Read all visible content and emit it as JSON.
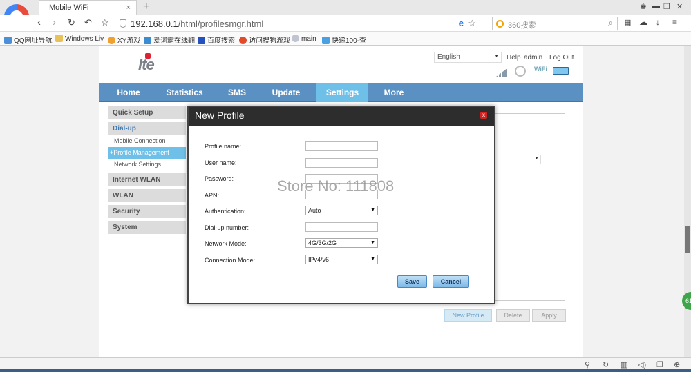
{
  "browser": {
    "tab_title": "Mobile WiFi",
    "tab_close": "×",
    "new_tab": "+",
    "url_host": "192.168.0.1",
    "url_path": "/html/profilesmgr.html",
    "search_placeholder": "360搜索",
    "bookmarks": [
      "QQ网址导航",
      "Windows Liv",
      "XY游戏",
      "爱词霸在线翻",
      "百度搜索",
      "访问搜狗游戏",
      "main",
      "快递100-查"
    ]
  },
  "header": {
    "logo_text": "lte",
    "language": "English",
    "help": "Help",
    "user": "admin",
    "logout": "Log Out"
  },
  "mainnav": [
    "Home",
    "Statistics",
    "SMS",
    "Update",
    "Settings",
    "More"
  ],
  "sidebar": {
    "quick_setup": "Quick Setup",
    "dialup": "Dial-up",
    "dialup_items": [
      "Mobile Connection",
      "+Profile Management",
      "Network Settings"
    ],
    "internet_wlan": "Internet WLAN",
    "wlan": "WLAN",
    "security": "Security",
    "system": "System"
  },
  "page_buttons": {
    "new_profile": "New Profile",
    "delete": "Delete",
    "apply": "Apply"
  },
  "modal": {
    "title": "New Profile",
    "close": "x",
    "labels": {
      "profile_name": "Profile name:",
      "user_name": "User name:",
      "password": "Password:",
      "apn": "APN:",
      "authentication": "Authentication:",
      "dialup_number": "Dial-up number:",
      "network_mode": "Network Mode:",
      "connection_mode": "Connection Mode:"
    },
    "values": {
      "authentication": "Auto",
      "network_mode": "4G/3G/2G",
      "connection_mode": "IPv4/v6"
    },
    "save": "Save",
    "cancel": "Cancel"
  },
  "watermark": "Store No: 111808",
  "float_ball": "61"
}
